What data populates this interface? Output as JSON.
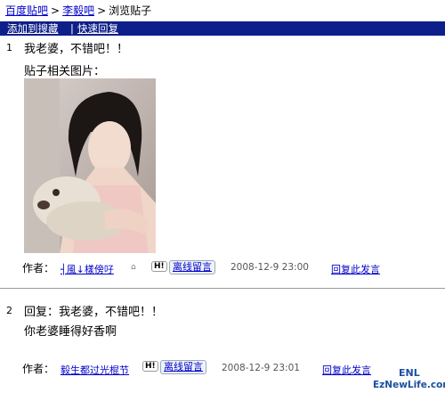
{
  "breadcrumb": {
    "items": [
      "百度贴吧",
      "李毅吧",
      "浏览贴子"
    ],
    "separator": ">"
  },
  "toolbar": {
    "add_favorite": "添加到搜藏",
    "divider": "|",
    "quick_reply": "快速回复"
  },
  "posts": [
    {
      "number": "1",
      "title": "我老婆，不错吧！！",
      "images_label": "贴子相关图片：",
      "author_label": "作者：",
      "author": "┤風↓樣傍吇",
      "message_button": "离线留言",
      "date": "2008-12-9 23:00",
      "reply_link": "回复此发言"
    },
    {
      "number": "2",
      "title": "回复：我老婆，不错吧！！",
      "body": "你老婆睡得好香啊",
      "author_label": "作者：",
      "author": "毅生都过光棍节",
      "message_button": "离线留言",
      "date": "2008-12-9 23:01",
      "reply_link": "回复此发言"
    }
  ],
  "watermark": {
    "line1": "ENL",
    "line2": "EzNewLife.com"
  },
  "colors": {
    "bar": "#0f1f8a",
    "link": "#0000cc"
  }
}
